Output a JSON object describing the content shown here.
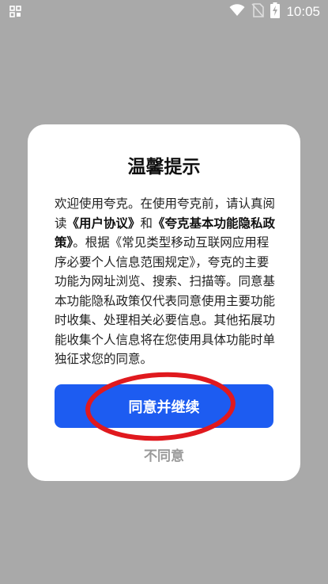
{
  "status_bar": {
    "time": "10:05",
    "icons": [
      "grid-app-icon",
      "wifi-icon",
      "no-sim-icon",
      "battery-charging-icon"
    ],
    "colors": {
      "text": "#ffffff"
    }
  },
  "dialog": {
    "title": "温馨提示",
    "body": {
      "p1": "欢迎使用夸克。在使用夸克前，请认真阅读",
      "link1": "《用户协议》",
      "p2": "和",
      "link2": "《夸克基本功能隐私政策》",
      "p3": "。根据《常见类型移动互联网应用程序必要个人信息范围规定》，夸克的主要功能为网址浏览、搜索、扫描等。同意基本功能隐私政策仅代表同意使用主要功能时收集、处理相关必要信息。其他拓展功能收集个人信息将在您使用具体功能时单独征求您的同意。"
    },
    "primary_button": "同意并继续",
    "secondary_button": "不同意",
    "colors": {
      "accent": "#1d5cf1",
      "overlay": "#a9a9a9",
      "annotation": "#e0191e"
    }
  }
}
